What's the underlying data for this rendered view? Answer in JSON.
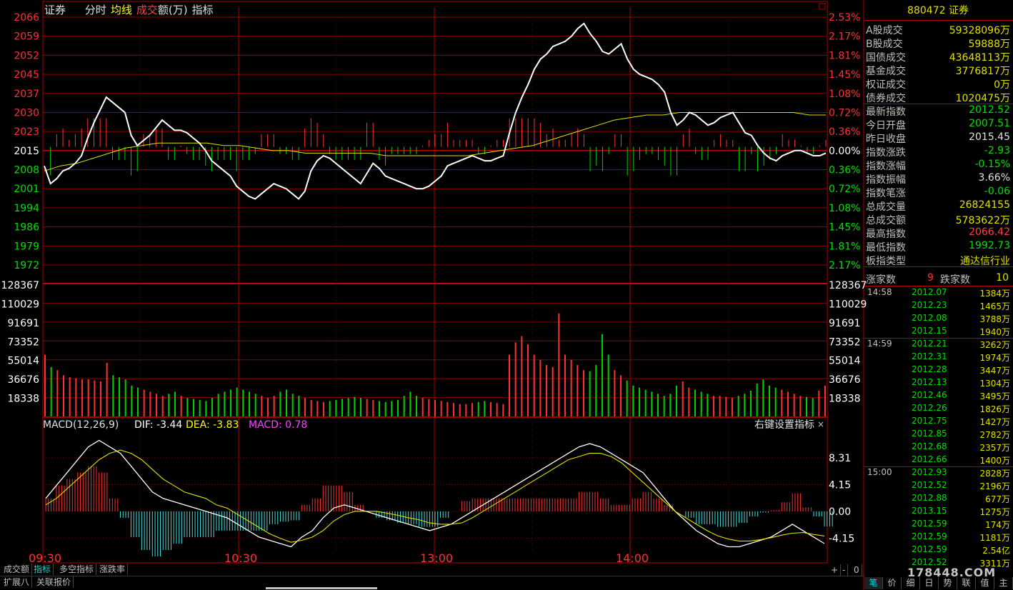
{
  "header": {
    "name": "证券",
    "items": [
      {
        "label": "分时",
        "color": "#e0e0e0"
      },
      {
        "label": "均线",
        "color": "#ffff00"
      },
      {
        "label": "成交",
        "color": "#ff4040"
      },
      {
        "label": "额(万)",
        "color": "#e0e0e0"
      },
      {
        "label": "指标",
        "color": "#e0e0e0"
      }
    ]
  },
  "price_axis_left": [
    "2066",
    "2059",
    "2052",
    "2045",
    "2037",
    "2030",
    "2023",
    "2015",
    "2008",
    "2001",
    "1994",
    "1986",
    "1979",
    "1972"
  ],
  "price_axis_right": [
    "2.53%",
    "2.17%",
    "1.81%",
    "1.45%",
    "1.08%",
    "0.72%",
    "0.36%",
    "0.00%",
    "0.36%",
    "0.72%",
    "1.08%",
    "1.45%",
    "1.81%",
    "2.17%"
  ],
  "volume_axis": [
    "128367",
    "110029",
    "91691",
    "73352",
    "55014",
    "36676",
    "18338"
  ],
  "macd_header": {
    "name": "MACD(12,26,9)",
    "dif_label": "DIF: -3.44",
    "dea_label": "DEA: -3.83",
    "macd_label": "MACD: 0.78",
    "right_label": "右键设置指标",
    "close": "×"
  },
  "macd_axis": [
    "8.31",
    "4.15",
    "0.00",
    "-4.15"
  ],
  "time_axis": [
    "09:30",
    "10:30",
    "13:00",
    "14:00"
  ],
  "chart_data": {
    "type": "line",
    "title": "880472 证券 分时",
    "prev_close": 2015.45,
    "price_ylim": [
      1969,
      2066.5
    ],
    "price": [
      2008,
      2001,
      2003,
      2006,
      2007,
      2009,
      2012,
      2019,
      2025,
      2030,
      2035,
      2033,
      2031,
      2029,
      2020,
      2016,
      2018,
      2020,
      2023,
      2026,
      2024,
      2022,
      2022,
      2021,
      2019,
      2017,
      2014,
      2010,
      2008,
      2006,
      2004,
      2000,
      1998,
      1996,
      1995,
      1997,
      1999,
      2001,
      2000,
      1999,
      1997,
      1995,
      1998,
      2006,
      2010,
      2012,
      2011,
      2009,
      2007,
      2005,
      2003,
      2001,
      2005,
      2009,
      2007,
      2004,
      2003,
      2002,
      2001,
      2000,
      1999,
      1999,
      2000,
      2002,
      2004,
      2008,
      2009,
      2010,
      2011,
      2012,
      2011,
      2010,
      2010,
      2011,
      2012,
      2021,
      2029,
      2035,
      2040,
      2046,
      2050,
      2052,
      2055,
      2056,
      2057,
      2059,
      2062,
      2064,
      2060,
      2057,
      2053,
      2052,
      2054,
      2056,
      2050,
      2046,
      2044,
      2043,
      2042,
      2040,
      2037,
      2029,
      2024,
      2026,
      2029,
      2028,
      2026,
      2024,
      2025,
      2027,
      2028,
      2029,
      2025,
      2021,
      2020,
      2016,
      2013,
      2011,
      2010,
      2012,
      2013,
      2014,
      2014,
      2013,
      2012,
      2012,
      2013
    ],
    "average": [
      2006,
      2008,
      2009,
      2011,
      2013,
      2015,
      2016,
      2017,
      2017,
      2017,
      2017,
      2016,
      2016,
      2015,
      2014,
      2014,
      2013,
      2013,
      2013,
      2013,
      2013,
      2012,
      2012,
      2012,
      2012,
      2012,
      2012,
      2013,
      2014,
      2015,
      2016,
      2018,
      2020,
      2022,
      2024,
      2026,
      2027,
      2028,
      2028,
      2029,
      2029,
      2029,
      2029,
      2029,
      2029,
      2029,
      2029,
      2028,
      2028
    ],
    "volume_ylim": [
      0,
      128367
    ],
    "volume": [
      60000,
      48000,
      45000,
      40000,
      38000,
      37000,
      36000,
      36000,
      35000,
      34000,
      52000,
      40000,
      38000,
      36000,
      30000,
      28000,
      26000,
      24000,
      22000,
      20000,
      22000,
      24000,
      20000,
      18000,
      17000,
      16000,
      15000,
      18000,
      22000,
      24000,
      26000,
      28000,
      26000,
      24000,
      22000,
      20000,
      18000,
      20000,
      24000,
      26000,
      22000,
      20000,
      18000,
      16000,
      15000,
      14000,
      15000,
      16000,
      17000,
      18000,
      19000,
      18000,
      17000,
      16000,
      15000,
      14000,
      15000,
      16000,
      20000,
      24000,
      20000,
      18000,
      17000,
      16000,
      15000,
      14000,
      13000,
      12000,
      12000,
      13000,
      14000,
      15000,
      14000,
      13000,
      12000,
      60000,
      72000,
      78000,
      70000,
      60000,
      55000,
      50000,
      48000,
      100000,
      60000,
      55000,
      50000,
      45000,
      44000,
      50000,
      80000,
      60000,
      45000,
      40000,
      35000,
      30000,
      28000,
      26000,
      24000,
      22000,
      20000,
      22000,
      30000,
      34000,
      28000,
      26000,
      24000,
      22000,
      20000,
      20000,
      19000,
      18000,
      20000,
      22000,
      25000,
      32000,
      36000,
      30000,
      28000,
      26000,
      24000,
      22000,
      20000,
      19000,
      18000,
      25000,
      30000
    ],
    "macd_ylim": [
      -6,
      12.5
    ],
    "dif": [
      2,
      4,
      6,
      8,
      10,
      11,
      10,
      9,
      7,
      5,
      3,
      2,
      1.5,
      1,
      0.5,
      0,
      -0.5,
      -1,
      -2,
      -3,
      -4,
      -4.5,
      -5,
      -5.5,
      -4,
      -3,
      -1,
      0.5,
      1,
      0.5,
      0,
      -0.5,
      -1,
      -1.5,
      -2,
      -2.5,
      -3,
      -2.5,
      -2,
      -1,
      0,
      1,
      2,
      3,
      4,
      5,
      6,
      7,
      8,
      9,
      10,
      10.5,
      10,
      9,
      8,
      7,
      6,
      4,
      2,
      0,
      -1.5,
      -3,
      -4,
      -5,
      -5.5,
      -5.5,
      -5,
      -4.5,
      -4,
      -3,
      -2,
      -3,
      -4,
      -5
    ],
    "dea": [
      1,
      2,
      3.5,
      5,
      6.5,
      8,
      9,
      9.5,
      9,
      8,
      6.5,
      5,
      4,
      3,
      2.5,
      2,
      1,
      0.5,
      -0.5,
      -1.5,
      -2.5,
      -3.5,
      -4.2,
      -4.8,
      -4.5,
      -4,
      -3,
      -1.5,
      -0.5,
      0,
      0,
      0,
      -0.3,
      -0.6,
      -1,
      -1.3,
      -1.8,
      -2,
      -2,
      -1.8,
      -1,
      0,
      1,
      2,
      3,
      4,
      5,
      6,
      7,
      8,
      8.5,
      9,
      9,
      8.5,
      7.5,
      6,
      4.5,
      3,
      1.5,
      0,
      -1,
      -2,
      -3,
      -3.8,
      -4.3,
      -4.6,
      -4.6,
      -4.4,
      -4.1,
      -3.7,
      -3.4,
      -3.3,
      -3.6,
      -3.83
    ]
  },
  "quote_panel": {
    "title_code": "880472",
    "title_name": "证券",
    "stats": [
      {
        "k": "A股成交",
        "v": "59328096万",
        "c": "#e0e000"
      },
      {
        "k": "B股成交",
        "v": "59888万",
        "c": "#e0e000"
      },
      {
        "k": "国债成交",
        "v": "43648113万",
        "c": "#e0e000"
      },
      {
        "k": "基金成交",
        "v": "3776817万",
        "c": "#e0e000"
      },
      {
        "k": "权证成交",
        "v": "0万",
        "c": "#e0e000"
      },
      {
        "k": "债券成交",
        "v": "1020475万",
        "c": "#e0e000"
      },
      {
        "k": "最新指数",
        "v": "2012.52",
        "c": "#00e000"
      },
      {
        "k": "今日开盘",
        "v": "2007.51",
        "c": "#00e000"
      },
      {
        "k": "昨日收盘",
        "v": "2015.45",
        "c": "#e0e0e0"
      },
      {
        "k": "指数涨跌",
        "v": "-2.93",
        "c": "#00e000"
      },
      {
        "k": "指数涨幅",
        "v": "-0.15%",
        "c": "#00e000"
      },
      {
        "k": "指数振幅",
        "v": "3.66%",
        "c": "#e0e0e0"
      },
      {
        "k": "指数笔涨",
        "v": "-0.06",
        "c": "#00e000"
      },
      {
        "k": "总成交量",
        "v": "26824155",
        "c": "#e0e000"
      },
      {
        "k": "总成交额",
        "v": "5783622万",
        "c": "#e0e000"
      },
      {
        "k": "最高指数",
        "v": "2066.42",
        "c": "#ff4040"
      },
      {
        "k": "最低指数",
        "v": "1992.73",
        "c": "#00e000"
      },
      {
        "k": "板指类型",
        "v": "通达信行业",
        "c": "#e0e000"
      }
    ],
    "breadth": {
      "up_label": "涨家数",
      "up": "9",
      "down_label": "跌家数",
      "down": "10"
    },
    "ticks": [
      {
        "t": "14:58",
        "p": "2012.07",
        "q": "1384万"
      },
      {
        "t": "",
        "p": "2012.23",
        "q": "1465万"
      },
      {
        "t": "",
        "p": "2012.08",
        "q": "3788万"
      },
      {
        "t": "",
        "p": "2012.15",
        "q": "1940万"
      },
      {
        "t": "14:59",
        "p": "2012.21",
        "q": "3262万"
      },
      {
        "t": "",
        "p": "2012.31",
        "q": "1974万"
      },
      {
        "t": "",
        "p": "2012.28",
        "q": "3447万"
      },
      {
        "t": "",
        "p": "2012.13",
        "q": "1304万"
      },
      {
        "t": "",
        "p": "2012.46",
        "q": "3495万"
      },
      {
        "t": "",
        "p": "2012.26",
        "q": "1826万"
      },
      {
        "t": "",
        "p": "2012.75",
        "q": "1427万"
      },
      {
        "t": "",
        "p": "2012.85",
        "q": "2782万"
      },
      {
        "t": "",
        "p": "2012.68",
        "q": "2357万"
      },
      {
        "t": "",
        "p": "2012.66",
        "q": "1400万"
      },
      {
        "t": "15:00",
        "p": "2012.93",
        "q": "2828万"
      },
      {
        "t": "",
        "p": "2012.52",
        "q": "2196万"
      },
      {
        "t": "",
        "p": "2012.88",
        "q": "677万"
      },
      {
        "t": "",
        "p": "2013.15",
        "q": "1275万"
      },
      {
        "t": "",
        "p": "2012.59",
        "q": "174万"
      },
      {
        "t": "",
        "p": "2012.59",
        "q": "1181万"
      },
      {
        "t": "",
        "p": "2012.59",
        "q": "2.54亿"
      },
      {
        "t": "",
        "p": "2012.52",
        "q": "3311万"
      }
    ],
    "bottom_tabs": [
      "笔",
      "价",
      "细",
      "日",
      "势",
      "联",
      "值",
      "主"
    ]
  },
  "bottom_tabs_row1": [
    "成交额",
    "指标",
    "多空指标",
    "涨跌率"
  ],
  "bottom_tabs_row2": [
    "扩展八",
    "关联报价"
  ],
  "zoom_controls": [
    "+",
    "-",
    "0"
  ],
  "watermark": "178448.COM"
}
